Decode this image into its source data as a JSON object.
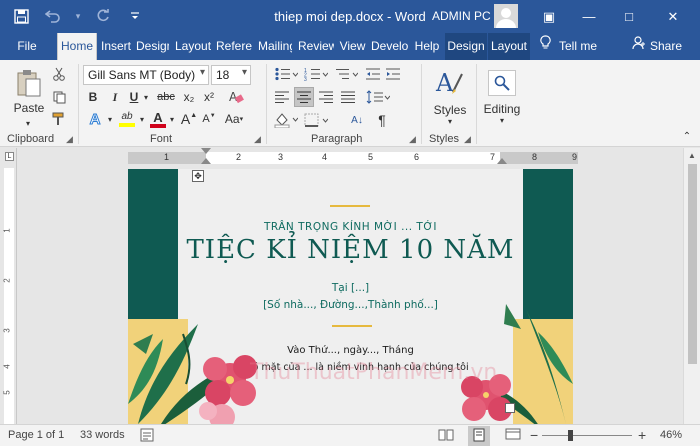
{
  "window": {
    "title": "thiep moi dep.docx  -  Word",
    "user": "ADMIN PC",
    "qat": {
      "save": "save-icon",
      "undo": "undo-icon",
      "redo": "redo-icon",
      "customize": "customize-icon"
    },
    "controls": {
      "ribbon_options": "▣",
      "minimize": "—",
      "maximize": "□",
      "close": "✕"
    }
  },
  "tabs": [
    {
      "label": "File"
    },
    {
      "label": "Home"
    },
    {
      "label": "Insert"
    },
    {
      "label": "Design"
    },
    {
      "label": "Layout"
    },
    {
      "label": "References"
    },
    {
      "label": "Mailings"
    },
    {
      "label": "Review"
    },
    {
      "label": "View"
    },
    {
      "label": "Developer"
    },
    {
      "label": "Help"
    },
    {
      "label": "Design"
    },
    {
      "label": "Layout"
    }
  ],
  "tellme": "Tell me",
  "share": "Share",
  "ribbon": {
    "clipboard": {
      "label": "Clipboard",
      "paste": "Paste"
    },
    "font": {
      "label": "Font",
      "font_name": "Gill Sans MT (Body)",
      "font_size": "18",
      "grow": "A",
      "shrink": "A",
      "case": "Aa",
      "bold": "B",
      "italic": "I",
      "underline": "U",
      "strike": "abc",
      "subscript": "x₂",
      "superscript": "x²",
      "text_effects": "A",
      "highlight": "ab",
      "font_color": "A"
    },
    "paragraph": {
      "label": "Paragraph",
      "sort": "A↓",
      "show_marks": "¶"
    },
    "styles": {
      "label": "Styles",
      "button": "Styles"
    },
    "editing": {
      "label": "Editing"
    }
  },
  "ruler": {
    "h_numbers": [
      "1",
      "2",
      "3",
      "4",
      "5",
      "6",
      "7",
      "8",
      "9"
    ],
    "v_numbers": [
      "1",
      "2",
      "3",
      "4",
      "5"
    ]
  },
  "document": {
    "line1": "TRÂN TRỌNG KÍNH MỜI ... TỚI",
    "title": "TIỆC KỈ NIỆM 10 NĂM",
    "at": "Tại [...]",
    "address": "[Số nhà..., Đường...,Thành phố...]",
    "date": "Vào Thứ..., ngày..., Tháng",
    "presence": "Sự có mặt của ... là niềm vinh hạnh của chúng tôi",
    "watermark": "ThuThuatPhanMem.vn"
  },
  "status": {
    "page": "Page 1 of 1",
    "words": "33 words",
    "zoom_out": "−",
    "zoom_in": "+",
    "zoom": "46%"
  },
  "colors": {
    "brand": "#2b579a",
    "accent_teal": "#0f5a52",
    "gold": "#e6b93e",
    "flower_pink": "#e0536f"
  }
}
